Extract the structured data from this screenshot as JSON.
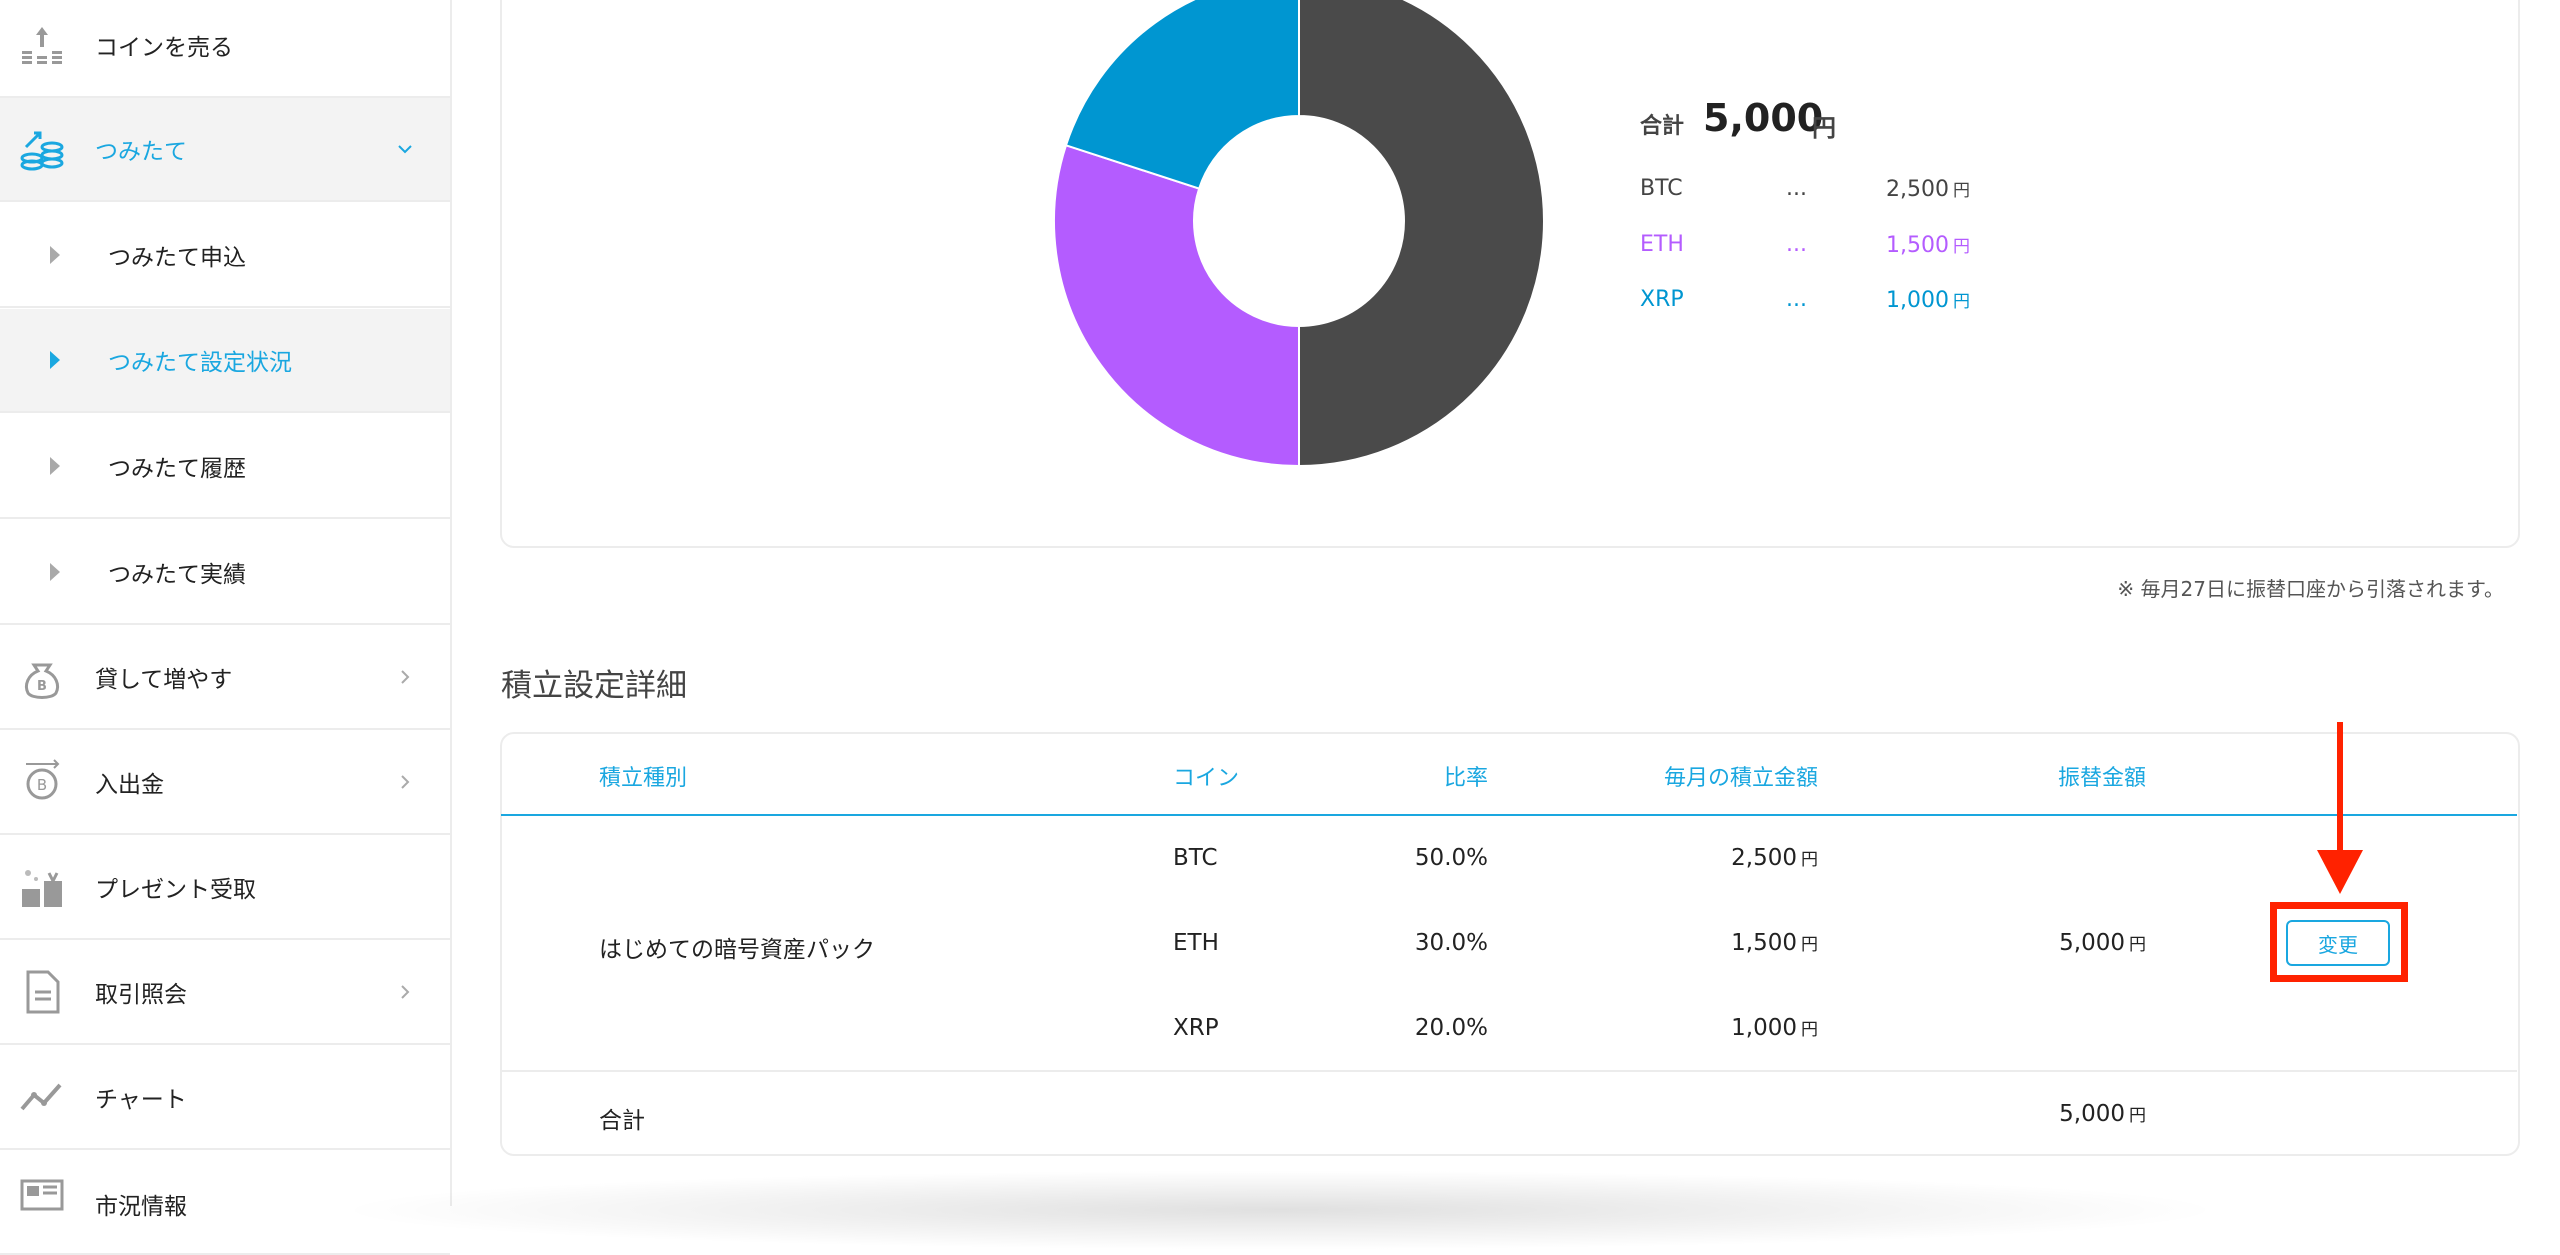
{
  "sidebar": {
    "items": [
      {
        "label": "コインを売る"
      },
      {
        "label": "つみたて"
      },
      {
        "label": "つみたて申込"
      },
      {
        "label": "つみたて設定状況"
      },
      {
        "label": "つみたて履歴"
      },
      {
        "label": "つみたて実績"
      },
      {
        "label": "貸して増やす"
      },
      {
        "label": "入出金"
      },
      {
        "label": "プレゼント受取"
      },
      {
        "label": "取引照会"
      },
      {
        "label": "チャート"
      },
      {
        "label": "市況情報"
      }
    ]
  },
  "chart_data": {
    "type": "pie",
    "categories": [
      "BTC",
      "ETH",
      "XRP"
    ],
    "values": [
      2500,
      1500,
      1000
    ],
    "colors": [
      "#4a4a4a",
      "#b45cff",
      "#0096d1"
    ]
  },
  "legend": {
    "total_label": "合計",
    "total_value": "5,000",
    "total_unit": "円",
    "rows": [
      {
        "symbol": "BTC",
        "dots": "...",
        "value": "2,500",
        "unit": "円",
        "color": "#444444"
      },
      {
        "symbol": "ETH",
        "dots": "...",
        "value": "1,500",
        "unit": "円",
        "color": "#b45cff"
      },
      {
        "symbol": "XRP",
        "dots": "...",
        "value": "1,000",
        "unit": "円",
        "color": "#0096d1"
      }
    ]
  },
  "note": "※ 毎月27日に振替口座から引落されます。",
  "section_title": "積立設定詳細",
  "table": {
    "headers": [
      "積立種別",
      "コイン",
      "比率",
      "毎月の積立金額",
      "振替金額"
    ],
    "plan_name": "はじめての暗号資産パック",
    "rows": [
      {
        "coin": "BTC",
        "ratio": "50.0%",
        "amount": "2,500",
        "unit": "円"
      },
      {
        "coin": "ETH",
        "ratio": "30.0%",
        "amount": "1,500",
        "unit": "円"
      },
      {
        "coin": "XRP",
        "ratio": "20.0%",
        "amount": "1,000",
        "unit": "円"
      }
    ],
    "transfer_amount": "5,000",
    "transfer_unit": "円",
    "change_label": "変更",
    "total_label": "合計",
    "total_amount": "5,000",
    "total_unit": "円"
  },
  "colors": {
    "accent": "#1aa7e0",
    "annotation": "#ff2200"
  }
}
